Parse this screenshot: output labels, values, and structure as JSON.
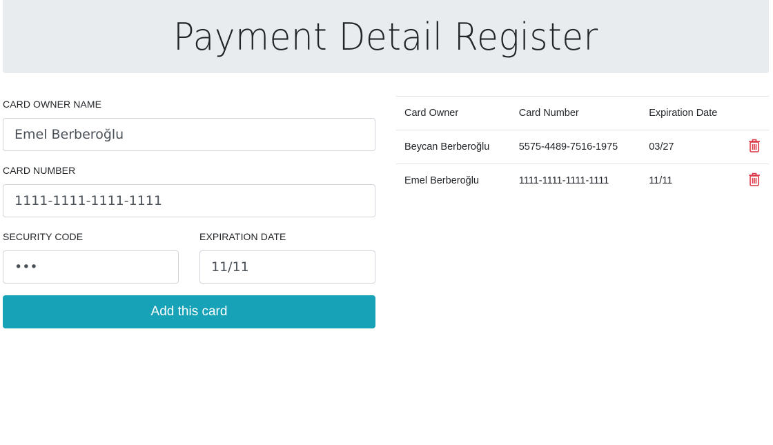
{
  "header": {
    "title": "Payment Detail Register"
  },
  "form": {
    "owner_label": "CARD OWNER NAME",
    "owner_value": "Emel Berberoğlu",
    "number_label": "CARD NUMBER",
    "number_value": "1111-1111-1111-1111",
    "security_label": "SECURITY CODE",
    "security_value": "•••",
    "expiration_label": "EXPIRATION DATE",
    "expiration_value": "11/11",
    "submit_label": "Add this card"
  },
  "table": {
    "headers": [
      "Card Owner",
      "Card Number",
      "Expiration Date"
    ],
    "rows": [
      {
        "owner": "Beycan Berberoğlu",
        "number": "5575-4489-7516-1975",
        "expiration": "03/27"
      },
      {
        "owner": "Emel Berberoğlu",
        "number": "1111-1111-1111-1111",
        "expiration": "11/11"
      }
    ]
  },
  "colors": {
    "header_bg": "#e9ecef",
    "button_bg": "#17a2b8",
    "delete_icon": "#dc3545"
  },
  "icons": {
    "delete": "trash-icon"
  }
}
